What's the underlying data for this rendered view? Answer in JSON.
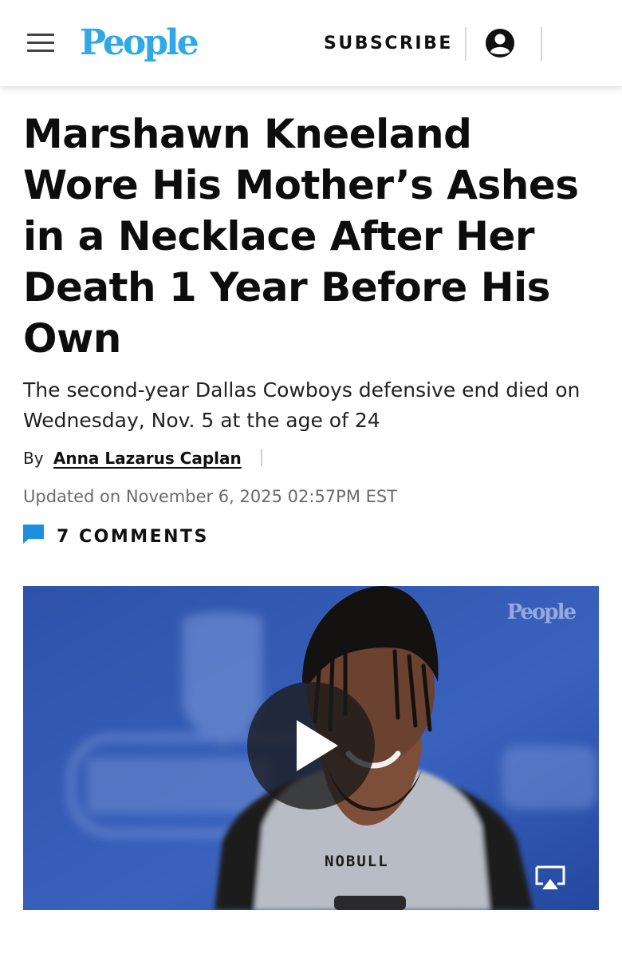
{
  "header": {
    "logo": "People",
    "subscribe_label": "SUBSCRIBE"
  },
  "article": {
    "headline": "Marshawn Kneeland Wore His Mother’s Ashes in a Necklace After Her Death 1 Year Before His Own",
    "dek": "The second-year Dallas Cowboys defensive end died on Wednesday, Nov. 5 at the age of 24",
    "byline_prefix": "By",
    "author": "Anna Lazarus Caplan",
    "updated": "Updated on November 6, 2025 02:57PM EST",
    "comments_label": "7 COMMENTS"
  },
  "video": {
    "watermark": "People",
    "shirt_text": "NOBULL"
  },
  "icons": {
    "menu": "hamburger-menu-icon",
    "account": "account-circle-icon",
    "comment": "comment-bubble-icon",
    "play": "play-icon",
    "airplay": "airplay-icon"
  },
  "colors": {
    "brand": "#30a8e6",
    "comment_icon": "#1d8fe0",
    "text": "#111111",
    "muted": "#6a6a6a"
  }
}
